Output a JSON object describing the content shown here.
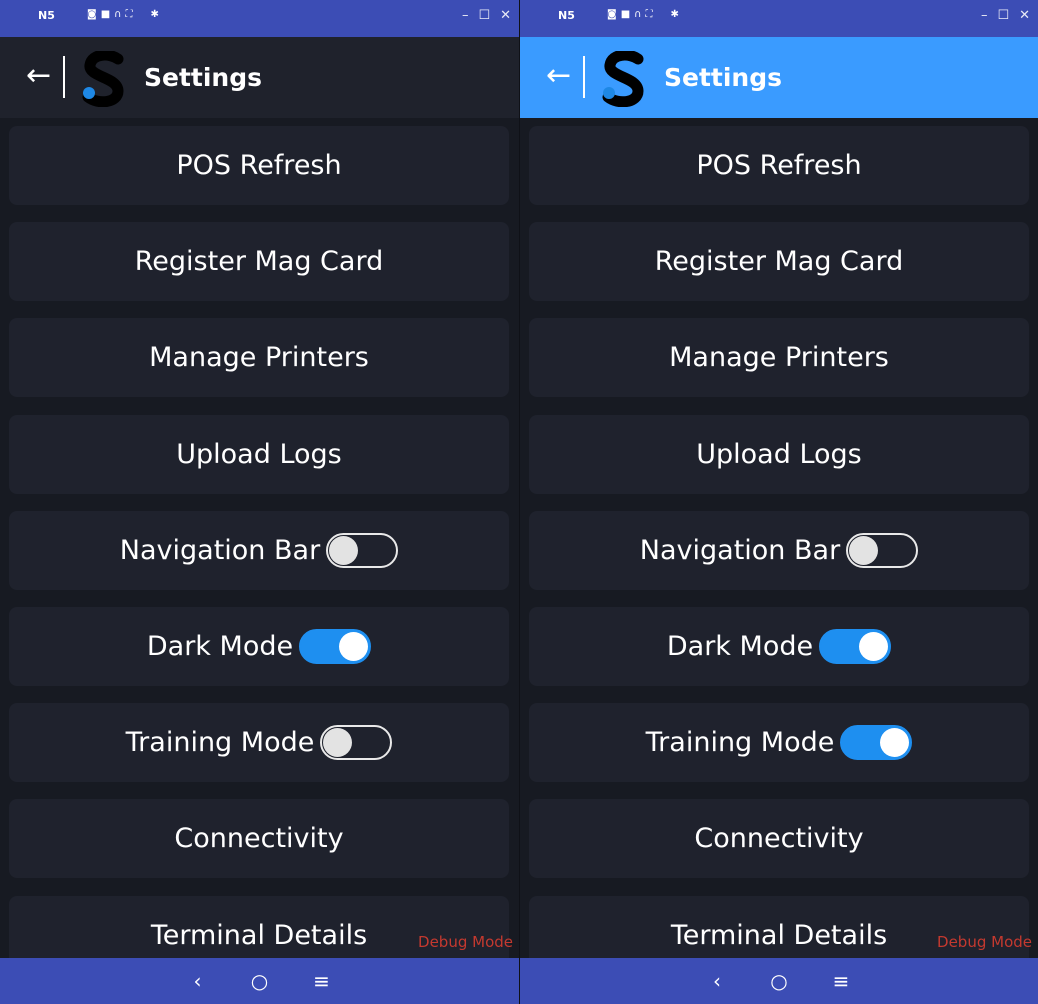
{
  "panels": [
    {
      "emulator": {
        "device": "N5"
      },
      "header": {
        "back_icon": "←",
        "title": "Settings",
        "color": "#1f222c"
      },
      "items": [
        {
          "label": "POS Refresh"
        },
        {
          "label": "Register Mag Card"
        },
        {
          "label": "Manage Printers"
        },
        {
          "label": "Upload Logs"
        },
        {
          "label": "Navigation Bar",
          "toggle": false
        },
        {
          "label": "Dark Mode",
          "toggle": true
        },
        {
          "label": "Training Mode",
          "toggle": false
        },
        {
          "label": "Connectivity"
        },
        {
          "label": "Terminal Details"
        }
      ],
      "debug_label": "Debug Mode",
      "nav": {
        "back": "‹",
        "home": "○",
        "menu": "≡"
      }
    },
    {
      "emulator": {
        "device": "N5"
      },
      "header": {
        "back_icon": "←",
        "title": "Settings",
        "color": "#3a9bff"
      },
      "items": [
        {
          "label": "POS Refresh"
        },
        {
          "label": "Register Mag Card"
        },
        {
          "label": "Manage Printers"
        },
        {
          "label": "Upload Logs"
        },
        {
          "label": "Navigation Bar",
          "toggle": false
        },
        {
          "label": "Dark Mode",
          "toggle": true
        },
        {
          "label": "Training Mode",
          "toggle": true
        },
        {
          "label": "Connectivity"
        },
        {
          "label": "Terminal Details"
        }
      ],
      "debug_label": "Debug Mode",
      "nav": {
        "back": "‹",
        "home": "○",
        "menu": "≡"
      }
    }
  ],
  "colors": {
    "emulator_bar": "#3c4db5",
    "background": "#171a22",
    "card": "#1f222d",
    "toggle_on": "#1e8ff0",
    "debug_text": "#c4392f"
  },
  "icons": {
    "emulator_tools": [
      "camera-icon",
      "video-icon",
      "headset-icon",
      "fullscreen-icon",
      "settings-icon"
    ],
    "window_controls": [
      "minimize-icon",
      "maximize-icon",
      "close-icon"
    ],
    "logo": "s-logo-icon"
  }
}
